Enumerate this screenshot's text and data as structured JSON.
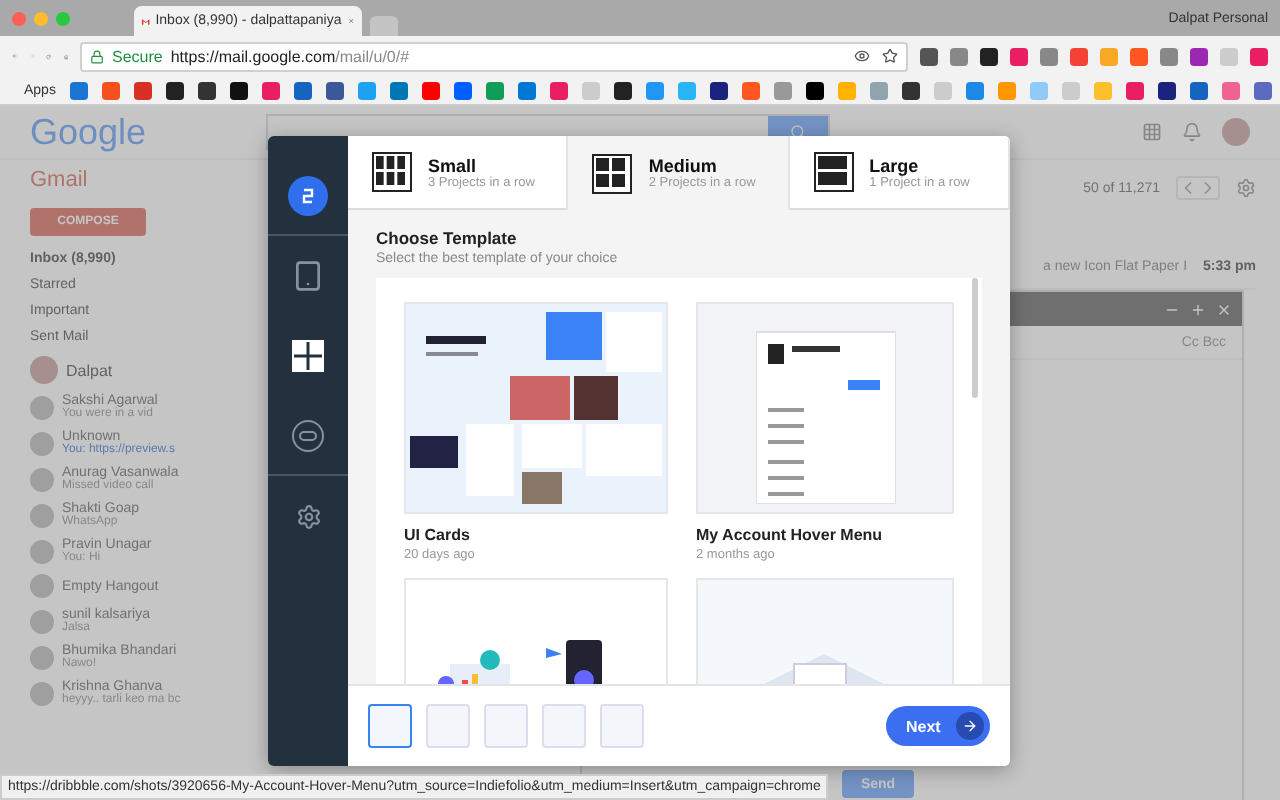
{
  "browser": {
    "tab_title": "Inbox (8,990) - dalpattapaniya",
    "profile": "Dalpat Personal",
    "secure_label": "Secure",
    "url_host": "https://mail.google.com",
    "url_path": "/mail/u/0/#",
    "apps_label": "Apps"
  },
  "gmail": {
    "logo": "Google",
    "app_label": "Gmail",
    "compose": "COMPOSE",
    "folders": [
      "Inbox (8,990)",
      "Starred",
      "Important",
      "Sent Mail"
    ],
    "account": "Dalpat",
    "contacts": [
      {
        "name": "Sakshi Agarwal",
        "snippet": "You were in a vid"
      },
      {
        "name": "Unknown",
        "snippet": "You: https://preview.s"
      },
      {
        "name": "Anurag Vasanwala",
        "snippet": "Missed video call"
      },
      {
        "name": "Shakti Goap",
        "snippet": "WhatsApp"
      },
      {
        "name": "Pravin Unagar",
        "snippet": "You: Hi"
      },
      {
        "name": "Empty Hangout"
      },
      {
        "name": "sunil kalsariya",
        "snippet": "Jalsa"
      },
      {
        "name": "Bhumika Bhandari",
        "snippet": "Nawo!"
      },
      {
        "name": "Krishna Ghanva",
        "snippet": "heyyy.. tarli keo ma bc"
      }
    ],
    "pagination": "50 of 11,271",
    "mail_row": {
      "subject": "a new Icon Flat Paper I",
      "time": "5:33 pm"
    },
    "compose_window": {
      "cc_bcc": "Cc Bcc",
      "send": "Send"
    }
  },
  "modal": {
    "nav": [
      {
        "kind": "logo"
      },
      {
        "kind": "tablet",
        "selected": false
      },
      {
        "kind": "grid",
        "selected": true
      },
      {
        "kind": "link",
        "selected": false
      },
      {
        "kind": "settings",
        "selected": false
      }
    ],
    "tabs": [
      {
        "kind": "small",
        "label": "Small",
        "sublabel": "3 Projects in a row",
        "selected": false
      },
      {
        "kind": "medium",
        "label": "Medium",
        "sublabel": "2 Projects in a row",
        "selected": true
      },
      {
        "kind": "large",
        "label": "Large",
        "sublabel": "1 Project in a row",
        "selected": false
      }
    ],
    "heading": "Choose Template",
    "subheading": "Select the best template of your choice",
    "templates": [
      {
        "kind": "cards",
        "title": "UI Cards",
        "date": "20 days ago"
      },
      {
        "kind": "menu",
        "title": "My Account Hover Menu",
        "date": "2 months ago"
      },
      {
        "kind": "devices"
      },
      {
        "kind": "isometric"
      }
    ],
    "thumbnails": [
      {
        "selected": true
      },
      {
        "selected": false
      },
      {
        "selected": false
      },
      {
        "selected": false
      },
      {
        "selected": false
      }
    ],
    "next": "Next"
  },
  "status_url": "https://dribbble.com/shots/3920656-My-Account-Hover-Menu?utm_source=Indiefolio&utm_medium=Insert&utm_campaign=chrome"
}
